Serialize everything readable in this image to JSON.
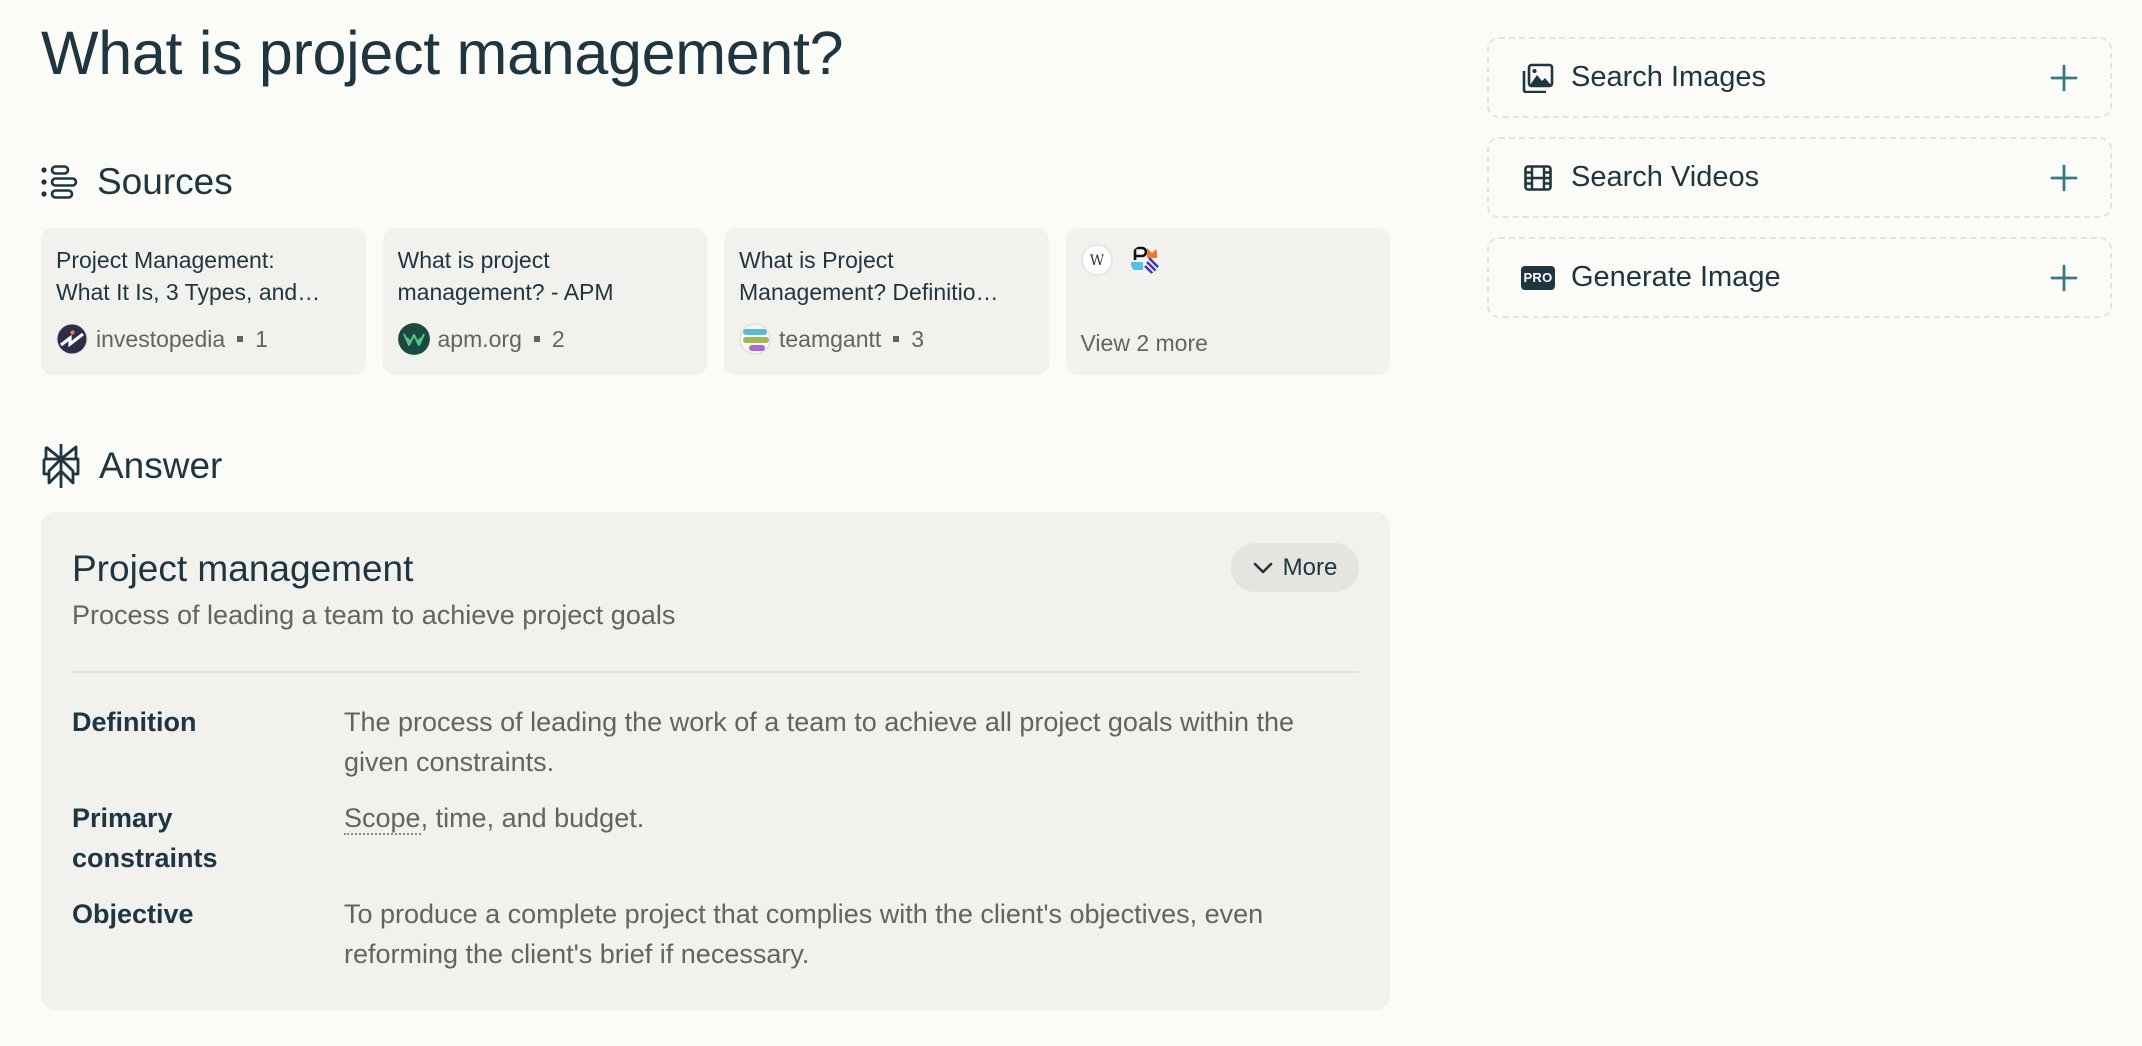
{
  "page": {
    "title": "What is project management?"
  },
  "sources": {
    "header": "Sources",
    "icon": "sources-list-icon",
    "items": [
      {
        "title_line1": "Project Management:",
        "title_line2": "What It Is, 3 Types, and…",
        "site": "investopedia",
        "index": "1",
        "favicon": "investopedia-favicon"
      },
      {
        "title_line1": "What is project",
        "title_line2": "management? - APM",
        "site": "apm.org",
        "index": "2",
        "favicon": "apm-favicon"
      },
      {
        "title_line1": "What is Project",
        "title_line2": "Management? Definitio…",
        "site": "teamgantt",
        "index": "3",
        "favicon": "teamgantt-favicon"
      }
    ],
    "more": {
      "label": "View 2 more",
      "favicons": [
        "wikipedia-favicon",
        "pm-favicon"
      ],
      "wikipedia_glyph": "W"
    }
  },
  "answer": {
    "header": "Answer",
    "icon": "perplexity-logo-icon",
    "entity": {
      "title": "Project management",
      "subtitle": "Process of leading a team to achieve project goals",
      "more_label": "More"
    },
    "facts": [
      {
        "label": "Definition",
        "value": "The process of leading the work of a team to achieve all project goals within the given constraints."
      },
      {
        "label": "Primary constraints",
        "value_term": "Scope",
        "value_rest": ", time, and budget."
      },
      {
        "label": "Objective",
        "value": "To produce a complete project that complies with the client's objectives, even reforming the client's brief if necessary."
      }
    ]
  },
  "sidebar": {
    "items": [
      {
        "label": "Search Images",
        "icon": "image-gallery-icon"
      },
      {
        "label": "Search Videos",
        "icon": "film-icon"
      },
      {
        "label": "Generate Image",
        "icon": "pro-badge-icon",
        "badge": "PRO"
      }
    ]
  },
  "colors": {
    "background": "#fbfbf7",
    "card": "#f1f1ed",
    "text_primary": "#1f3540",
    "text_secondary": "#62645f",
    "accent_plus": "#3b7a85"
  }
}
